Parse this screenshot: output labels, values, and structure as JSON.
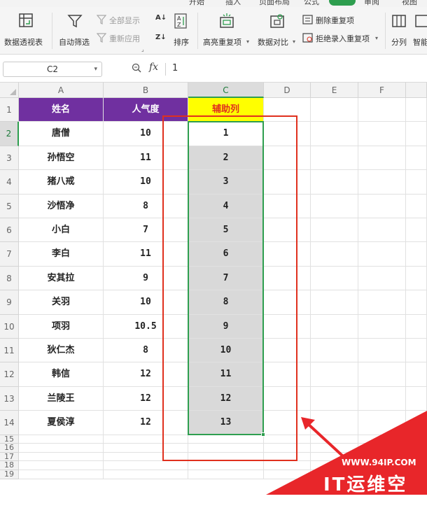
{
  "menu": {
    "items": [
      "开始",
      "插入",
      "页面布局",
      "公式",
      "数据",
      "审阅",
      "视图"
    ],
    "active": "数据"
  },
  "ribbon": {
    "pivot": "数据透视表",
    "autofilter": "自动筛选",
    "show_all": "全部显示",
    "reapply": "重新应用",
    "sort": "排序",
    "highlight_dup": "高亮重复项",
    "compare": "数据对比",
    "delete_dup": "删除重复项",
    "reject_dup": "拒绝录入重复项",
    "split": "分列",
    "smart": "智能"
  },
  "formula_bar": {
    "name_box": "C2",
    "fx": "fx",
    "value": "1"
  },
  "columns": [
    "A",
    "B",
    "C",
    "D",
    "E",
    "F"
  ],
  "header_row": {
    "a": "姓名",
    "b": "人气度",
    "c": "辅助列"
  },
  "rows": [
    {
      "n": "2",
      "a": "唐僧",
      "b": "10",
      "c": "1"
    },
    {
      "n": "3",
      "a": "孙悟空",
      "b": "11",
      "c": "2"
    },
    {
      "n": "4",
      "a": "猪八戒",
      "b": "10",
      "c": "3"
    },
    {
      "n": "5",
      "a": "沙悟净",
      "b": "8",
      "c": "4"
    },
    {
      "n": "6",
      "a": "小白",
      "b": "7",
      "c": "5"
    },
    {
      "n": "7",
      "a": "李白",
      "b": "11",
      "c": "6"
    },
    {
      "n": "8",
      "a": "安其拉",
      "b": "9",
      "c": "7"
    },
    {
      "n": "9",
      "a": "关羽",
      "b": "10",
      "c": "8"
    },
    {
      "n": "10",
      "a": "项羽",
      "b": "10.5",
      "c": "9"
    },
    {
      "n": "11",
      "a": "狄仁杰",
      "b": "8",
      "c": "10"
    },
    {
      "n": "12",
      "a": "韩信",
      "b": "12",
      "c": "11"
    },
    {
      "n": "13",
      "a": "兰陵王",
      "b": "12",
      "c": "12"
    },
    {
      "n": "14",
      "a": "夏侯淳",
      "b": "12",
      "c": "13"
    }
  ],
  "empty_rows": [
    "15",
    "16",
    "17",
    "18",
    "19"
  ],
  "watermark": {
    "url": "WWW.94IP.COM",
    "brand": "IT运维空间"
  },
  "colors": {
    "header_purple": "#7030a0",
    "helper_yellow": "#ffff00",
    "helper_red_text": "#e0301e",
    "selection_green": "#2e9e4f",
    "annotation_red": "#e0301e"
  }
}
